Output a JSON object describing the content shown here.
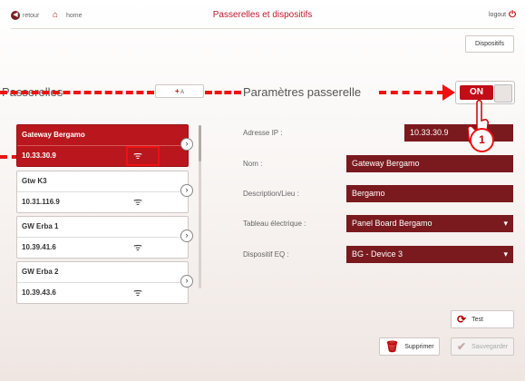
{
  "header": {
    "back_label": "retour",
    "home_label": "home",
    "title": "Passerelles et dispositifs",
    "logout_label": "logout",
    "dispositifs_label": "Dispositifs"
  },
  "left_panel": {
    "title": "Passerelles",
    "add_label": "A",
    "gateways": [
      {
        "name": "Gateway Bergamo",
        "ip": "10.33.30.9",
        "selected": true
      },
      {
        "name": "Gtw K3",
        "ip": "10.31.116.9",
        "selected": false
      },
      {
        "name": "GW Erba 1",
        "ip": "10.39.41.6",
        "selected": false
      },
      {
        "name": "GW Erba 2",
        "ip": "10.39.43.6",
        "selected": false
      }
    ]
  },
  "right_panel": {
    "title": "Paramètres passerelle",
    "toggle_label": "ON",
    "fields": {
      "ip": {
        "label": "Adresse IP :",
        "value": "10.33.30.9"
      },
      "name": {
        "label": "Nom :",
        "value": "Gateway Bergamo"
      },
      "description": {
        "label": "Description/Lieu :",
        "value": "Bergamo"
      },
      "panel": {
        "label": "Tableau électrique :",
        "value": "Panel Board Bergamo"
      },
      "device": {
        "label": "Dispositif EQ :",
        "value": "BG - Device 3"
      }
    },
    "test_label": "Test",
    "delete_label": "Supprimer",
    "save_label": "Sauvegarder"
  },
  "annotation": {
    "step_number": "1"
  },
  "colors": {
    "accent": "#c20d16",
    "field_bg": "#7a1a1e",
    "annotation": "#e11111"
  },
  "icons": {
    "back": "arrow-left-circle-icon",
    "home": "home-icon",
    "logout": "power-icon",
    "wifi": "wifi-icon",
    "chevron": "chevron-right-icon",
    "refresh": "refresh-icon",
    "trash": "trash-icon",
    "check": "check-icon"
  }
}
